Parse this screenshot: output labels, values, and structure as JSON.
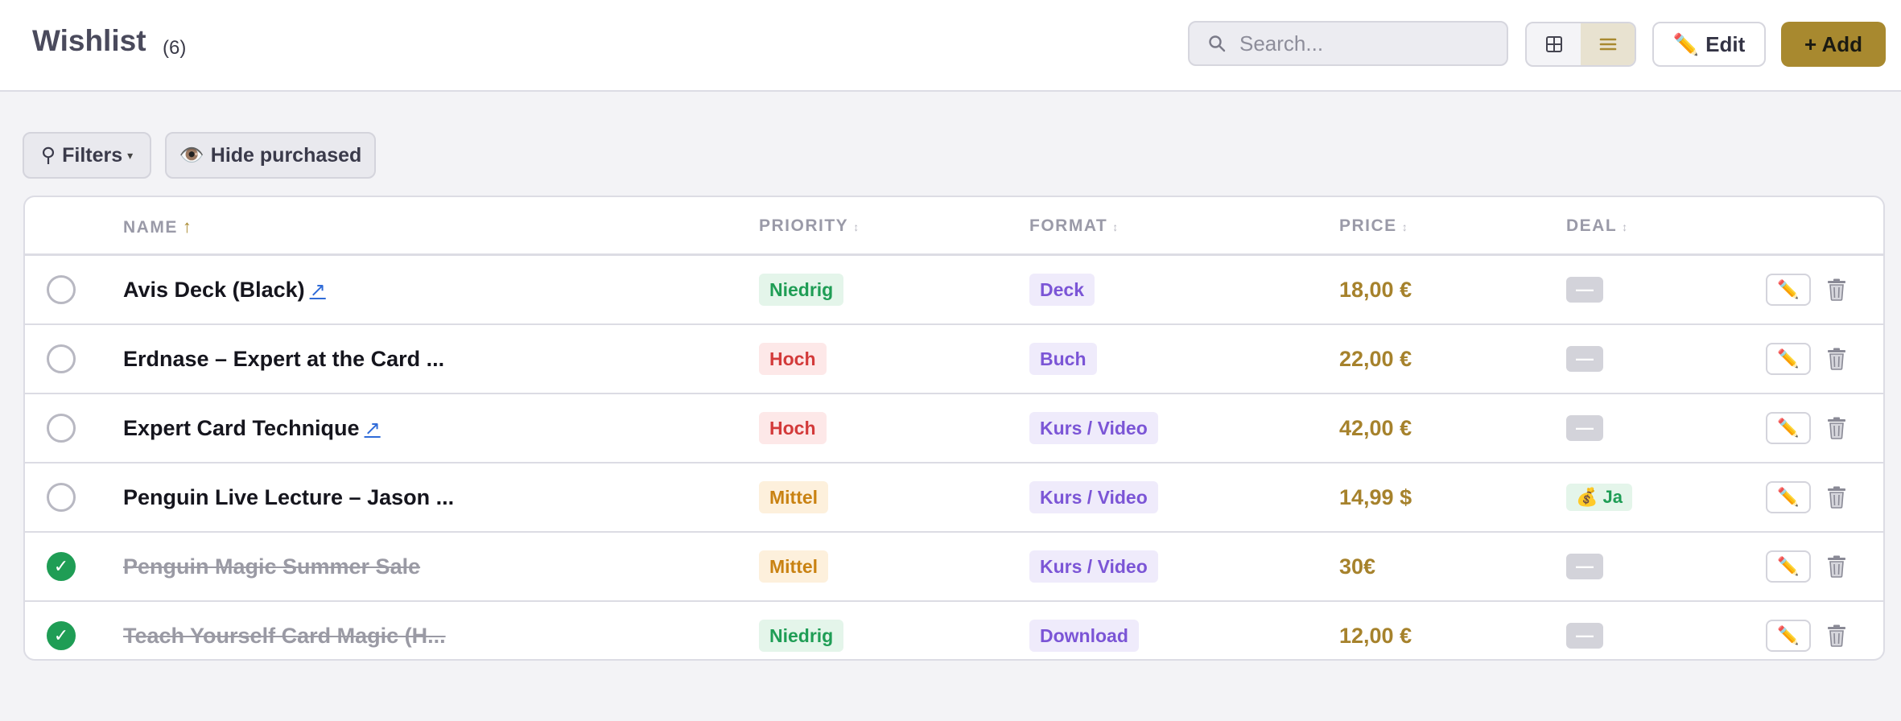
{
  "header": {
    "title": "Wishlist",
    "count": "(6)",
    "search_placeholder": "Search...",
    "edit_label": "Edit",
    "edit_icon": "✏️",
    "add_label": "+ Add"
  },
  "toolbar": {
    "filters_label": "Filters",
    "filters_icon": "⚲",
    "filters_caret": "▾",
    "hide_label": "Hide purchased",
    "hide_icon": "👁️"
  },
  "columns": {
    "name": "NAME",
    "priority": "PRIORITY",
    "format": "FORMAT",
    "price": "PRICE",
    "deal": "DEAL",
    "sort_active": "↑",
    "sort_idle": "↕"
  },
  "rows": [
    {
      "purchased": false,
      "name": "Avis Deck (Black)",
      "external_link": "↗",
      "priority": "Niedrig",
      "priority_color": "#1f9d55",
      "format": "Deck",
      "price": "18,00 €",
      "deal": "—"
    },
    {
      "purchased": false,
      "name": "Erdnase – Expert at the Card ...",
      "external_link": "",
      "priority": "Hoch",
      "priority_color": "#d33a3a",
      "format": "Buch",
      "price": "22,00 €",
      "deal": "—"
    },
    {
      "purchased": false,
      "name": "Expert Card Technique",
      "external_link": "↗",
      "priority": "Hoch",
      "priority_color": "#d33a3a",
      "format": "Kurs / Video",
      "price": "42,00 €",
      "deal": "—"
    },
    {
      "purchased": false,
      "name": "Penguin Live Lecture – Jason ...",
      "external_link": "",
      "priority": "Mittel",
      "priority_color": "#c98212",
      "format": "Kurs / Video",
      "price": "14,99 $",
      "deal": "💰 Ja"
    },
    {
      "purchased": true,
      "name": "Penguin Magic Summer Sale",
      "external_link": "",
      "priority": "Mittel",
      "priority_color": "#c98212",
      "format": "Kurs / Video",
      "price": "30€",
      "deal": "—"
    },
    {
      "purchased": true,
      "name": "Teach Yourself Card Magic (H...",
      "external_link": "",
      "priority": "Niedrig",
      "priority_color": "#1f9d55",
      "format": "Download",
      "price": "12,00 €",
      "deal": "—"
    }
  ],
  "row_actions": {
    "edit_icon": "✏️",
    "checkmark": "✓"
  },
  "colors": {
    "accent": "#a8892f",
    "purchased_green": "#1f9d55",
    "format_purple": "#7b55d6",
    "price_gold": "#a6822c"
  }
}
